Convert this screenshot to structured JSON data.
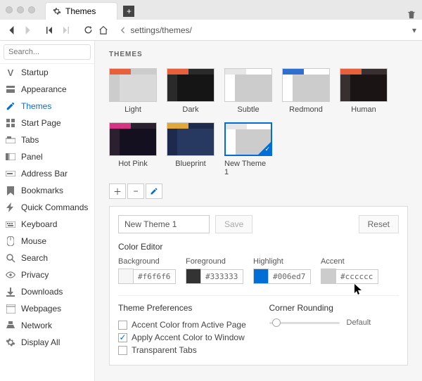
{
  "tab": {
    "title": "Themes"
  },
  "address": {
    "value": "settings/themes/"
  },
  "search": {
    "placeholder": "Search..."
  },
  "sidebar": [
    {
      "label": "Startup",
      "icon": "V"
    },
    {
      "label": "Appearance",
      "icon": "app"
    },
    {
      "label": "Themes",
      "icon": "pencil",
      "active": true
    },
    {
      "label": "Start Page",
      "icon": "grid"
    },
    {
      "label": "Tabs",
      "icon": "tab"
    },
    {
      "label": "Panel",
      "icon": "panel"
    },
    {
      "label": "Address Bar",
      "icon": "addr"
    },
    {
      "label": "Bookmarks",
      "icon": "bm"
    },
    {
      "label": "Quick Commands",
      "icon": "qc"
    },
    {
      "label": "Keyboard",
      "icon": "kb"
    },
    {
      "label": "Mouse",
      "icon": "mouse"
    },
    {
      "label": "Search",
      "icon": "search"
    },
    {
      "label": "Privacy",
      "icon": "priv"
    },
    {
      "label": "Downloads",
      "icon": "dl"
    },
    {
      "label": "Webpages",
      "icon": "wp"
    },
    {
      "label": "Network",
      "icon": "net"
    },
    {
      "label": "Display All",
      "icon": "da"
    }
  ],
  "page": {
    "heading": "THEMES"
  },
  "themes": [
    {
      "name": "Light",
      "top": "#e85f3c",
      "side": "#ccc",
      "main": "#d9d9d9"
    },
    {
      "name": "Dark",
      "top": "#e85f3c",
      "side": "#2a2a2a",
      "main": "#151515"
    },
    {
      "name": "Subtle",
      "top": "#e6e6e6",
      "side": "#fff",
      "main": "#ccc"
    },
    {
      "name": "Redmond",
      "top": "#2f6fd0",
      "side": "#fff",
      "main": "#ccc"
    },
    {
      "name": "Human",
      "top": "#e85f3c",
      "side": "#383030",
      "main": "#1a1414"
    },
    {
      "name": "Hot Pink",
      "top": "#d63384",
      "side": "#2a2030",
      "main": "#151020"
    },
    {
      "name": "Blueprint",
      "top": "#e0a838",
      "side": "#1e2a4d",
      "main": "#283961"
    },
    {
      "name": "New Theme 1",
      "top": "#e6e6e6",
      "side": "#fff",
      "main": "#ccc",
      "selected": true
    }
  ],
  "editor": {
    "name_value": "New Theme 1",
    "save": "Save",
    "reset": "Reset",
    "color_editor_title": "Color Editor",
    "colors": {
      "background": {
        "label": "Background",
        "value": "#f6f6f6",
        "swatch": "#f6f6f6"
      },
      "foreground": {
        "label": "Foreground",
        "value": "#333333",
        "swatch": "#333333"
      },
      "highlight": {
        "label": "Highlight",
        "value": "#006ed7",
        "swatch": "#006ed7"
      },
      "accent": {
        "label": "Accent",
        "value": "#cccccc",
        "swatch": "#cccccc"
      }
    },
    "prefs_title": "Theme Preferences",
    "prefs": [
      {
        "label": "Accent Color from Active Page",
        "checked": false
      },
      {
        "label": "Apply Accent Color to Window",
        "checked": true
      },
      {
        "label": "Transparent Tabs",
        "checked": false
      }
    ],
    "rounding_title": "Corner Rounding",
    "rounding_label": "Default"
  }
}
